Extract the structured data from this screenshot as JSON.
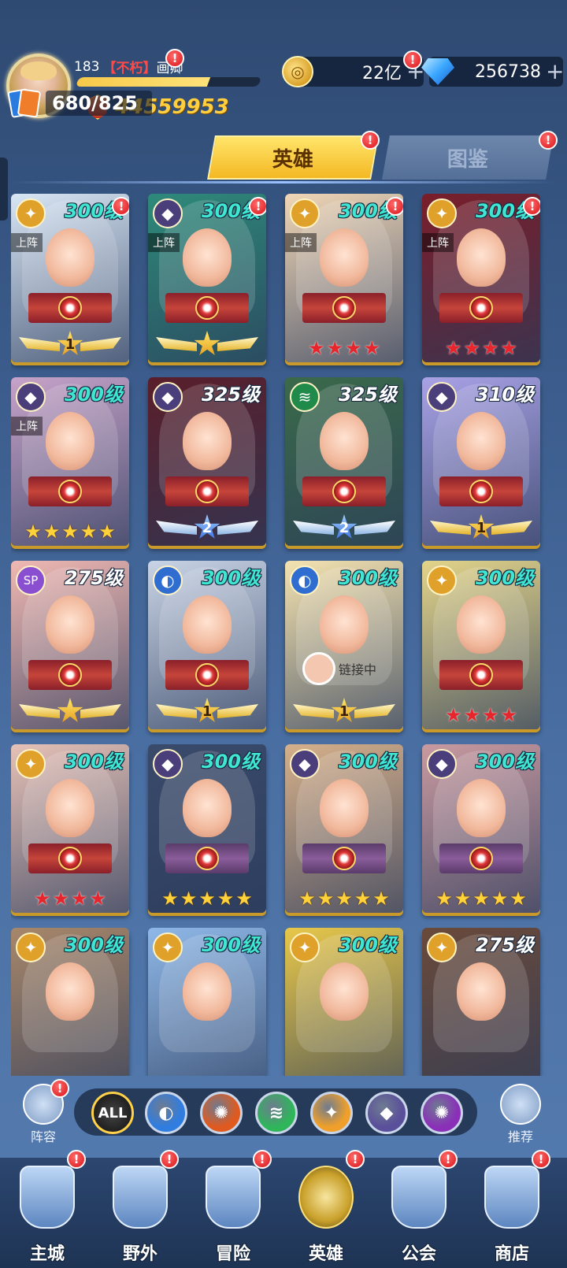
{
  "player": {
    "level": "183",
    "tag": "【不朽】",
    "name": "画卿",
    "xp_fraction": 0.72,
    "power": "44559953"
  },
  "currencies": {
    "gold": "22亿",
    "diamonds": "256738"
  },
  "hero_count": "680/825",
  "tabs": {
    "heroes": "英雄",
    "codex": "图鉴"
  },
  "labels": {
    "on_team": "上阵",
    "linking": "链接中"
  },
  "heroes": [
    {
      "level": "300级",
      "element": "light",
      "on_team": true,
      "stars": "wings-1",
      "art": "#d8e6f5"
    },
    {
      "level": "300级",
      "element": "void",
      "on_team": true,
      "stars": "wings-star",
      "art": "#2e8a7a"
    },
    {
      "level": "300级",
      "element": "light",
      "on_team": true,
      "stars": "red-4",
      "art": "#f0d6b6"
    },
    {
      "level": "300级",
      "element": "light",
      "on_team": true,
      "stars": "red-4",
      "art": "#7a1e2a"
    },
    {
      "level": "300级",
      "element": "void",
      "on_team": true,
      "stars": "gold-5",
      "art": "#c7a3c9"
    },
    {
      "level": "325级",
      "element": "void",
      "on_team": false,
      "stars": "wings-2",
      "art": "#5a1e2a"
    },
    {
      "level": "325级",
      "element": "wind",
      "on_team": false,
      "stars": "wings-2",
      "art": "#3a6a4a"
    },
    {
      "level": "310级",
      "element": "void",
      "on_team": false,
      "stars": "wings-1",
      "art": "#a9a2e6"
    },
    {
      "level": "275级",
      "element": "sp",
      "on_team": false,
      "stars": "wings-star",
      "art": "#f0b8b2"
    },
    {
      "level": "300级",
      "element": "water",
      "on_team": false,
      "stars": "wings-1",
      "art": "#c9d4e6"
    },
    {
      "level": "300级",
      "element": "water",
      "on_team": false,
      "stars": "wings-1",
      "art": "#f5e3b0",
      "linking": true
    },
    {
      "level": "300级",
      "element": "light",
      "on_team": false,
      "stars": "red-4",
      "art": "#e3d48a"
    },
    {
      "level": "300级",
      "element": "light",
      "on_team": false,
      "stars": "red-4",
      "art": "#e6c1b6"
    },
    {
      "level": "300级",
      "element": "void",
      "on_team": false,
      "stars": "gold-5",
      "art": "#3a4a6a"
    },
    {
      "level": "300级",
      "element": "void",
      "on_team": false,
      "stars": "gold-5",
      "art": "#d6b08a"
    },
    {
      "level": "300级",
      "element": "void",
      "on_team": false,
      "stars": "gold-5",
      "art": "#c99aa0"
    },
    {
      "level": "300级",
      "element": "light",
      "on_team": false,
      "stars": "",
      "art": "#a8876a"
    },
    {
      "level": "300级",
      "element": "light",
      "on_team": false,
      "stars": "",
      "art": "#8fb8e8"
    },
    {
      "level": "300级",
      "element": "light",
      "on_team": false,
      "stars": "",
      "art": "#e8c84a"
    },
    {
      "level": "275级",
      "element": "light",
      "on_team": false,
      "stars": "",
      "art": "#6a4a3a"
    }
  ],
  "filters": {
    "all": "ALL",
    "elements": [
      {
        "name": "water",
        "color": "#2f7de0"
      },
      {
        "name": "fire",
        "color": "#e05a1f"
      },
      {
        "name": "wind",
        "color": "#2fb55a"
      },
      {
        "name": "light",
        "color": "#f0a02a"
      },
      {
        "name": "void",
        "color": "#5a4f9a"
      },
      {
        "name": "dark",
        "color": "#8a2fb8"
      }
    ],
    "lineup": "阵容",
    "recommend": "推荐"
  },
  "nav": [
    {
      "label": "主城",
      "icon": "castle-icon"
    },
    {
      "label": "野外",
      "icon": "portal-icon"
    },
    {
      "label": "冒险",
      "icon": "trident-icon"
    },
    {
      "label": "英雄",
      "icon": "helmet-icon",
      "active": true
    },
    {
      "label": "公会",
      "icon": "banner-icon"
    },
    {
      "label": "商店",
      "icon": "shop-icon"
    }
  ],
  "colors": {
    "accent_gold": "#ffcf3f",
    "level_teal": "#3fe6d2",
    "star_red": "#e6262c",
    "badge_red": "#d9141a"
  }
}
